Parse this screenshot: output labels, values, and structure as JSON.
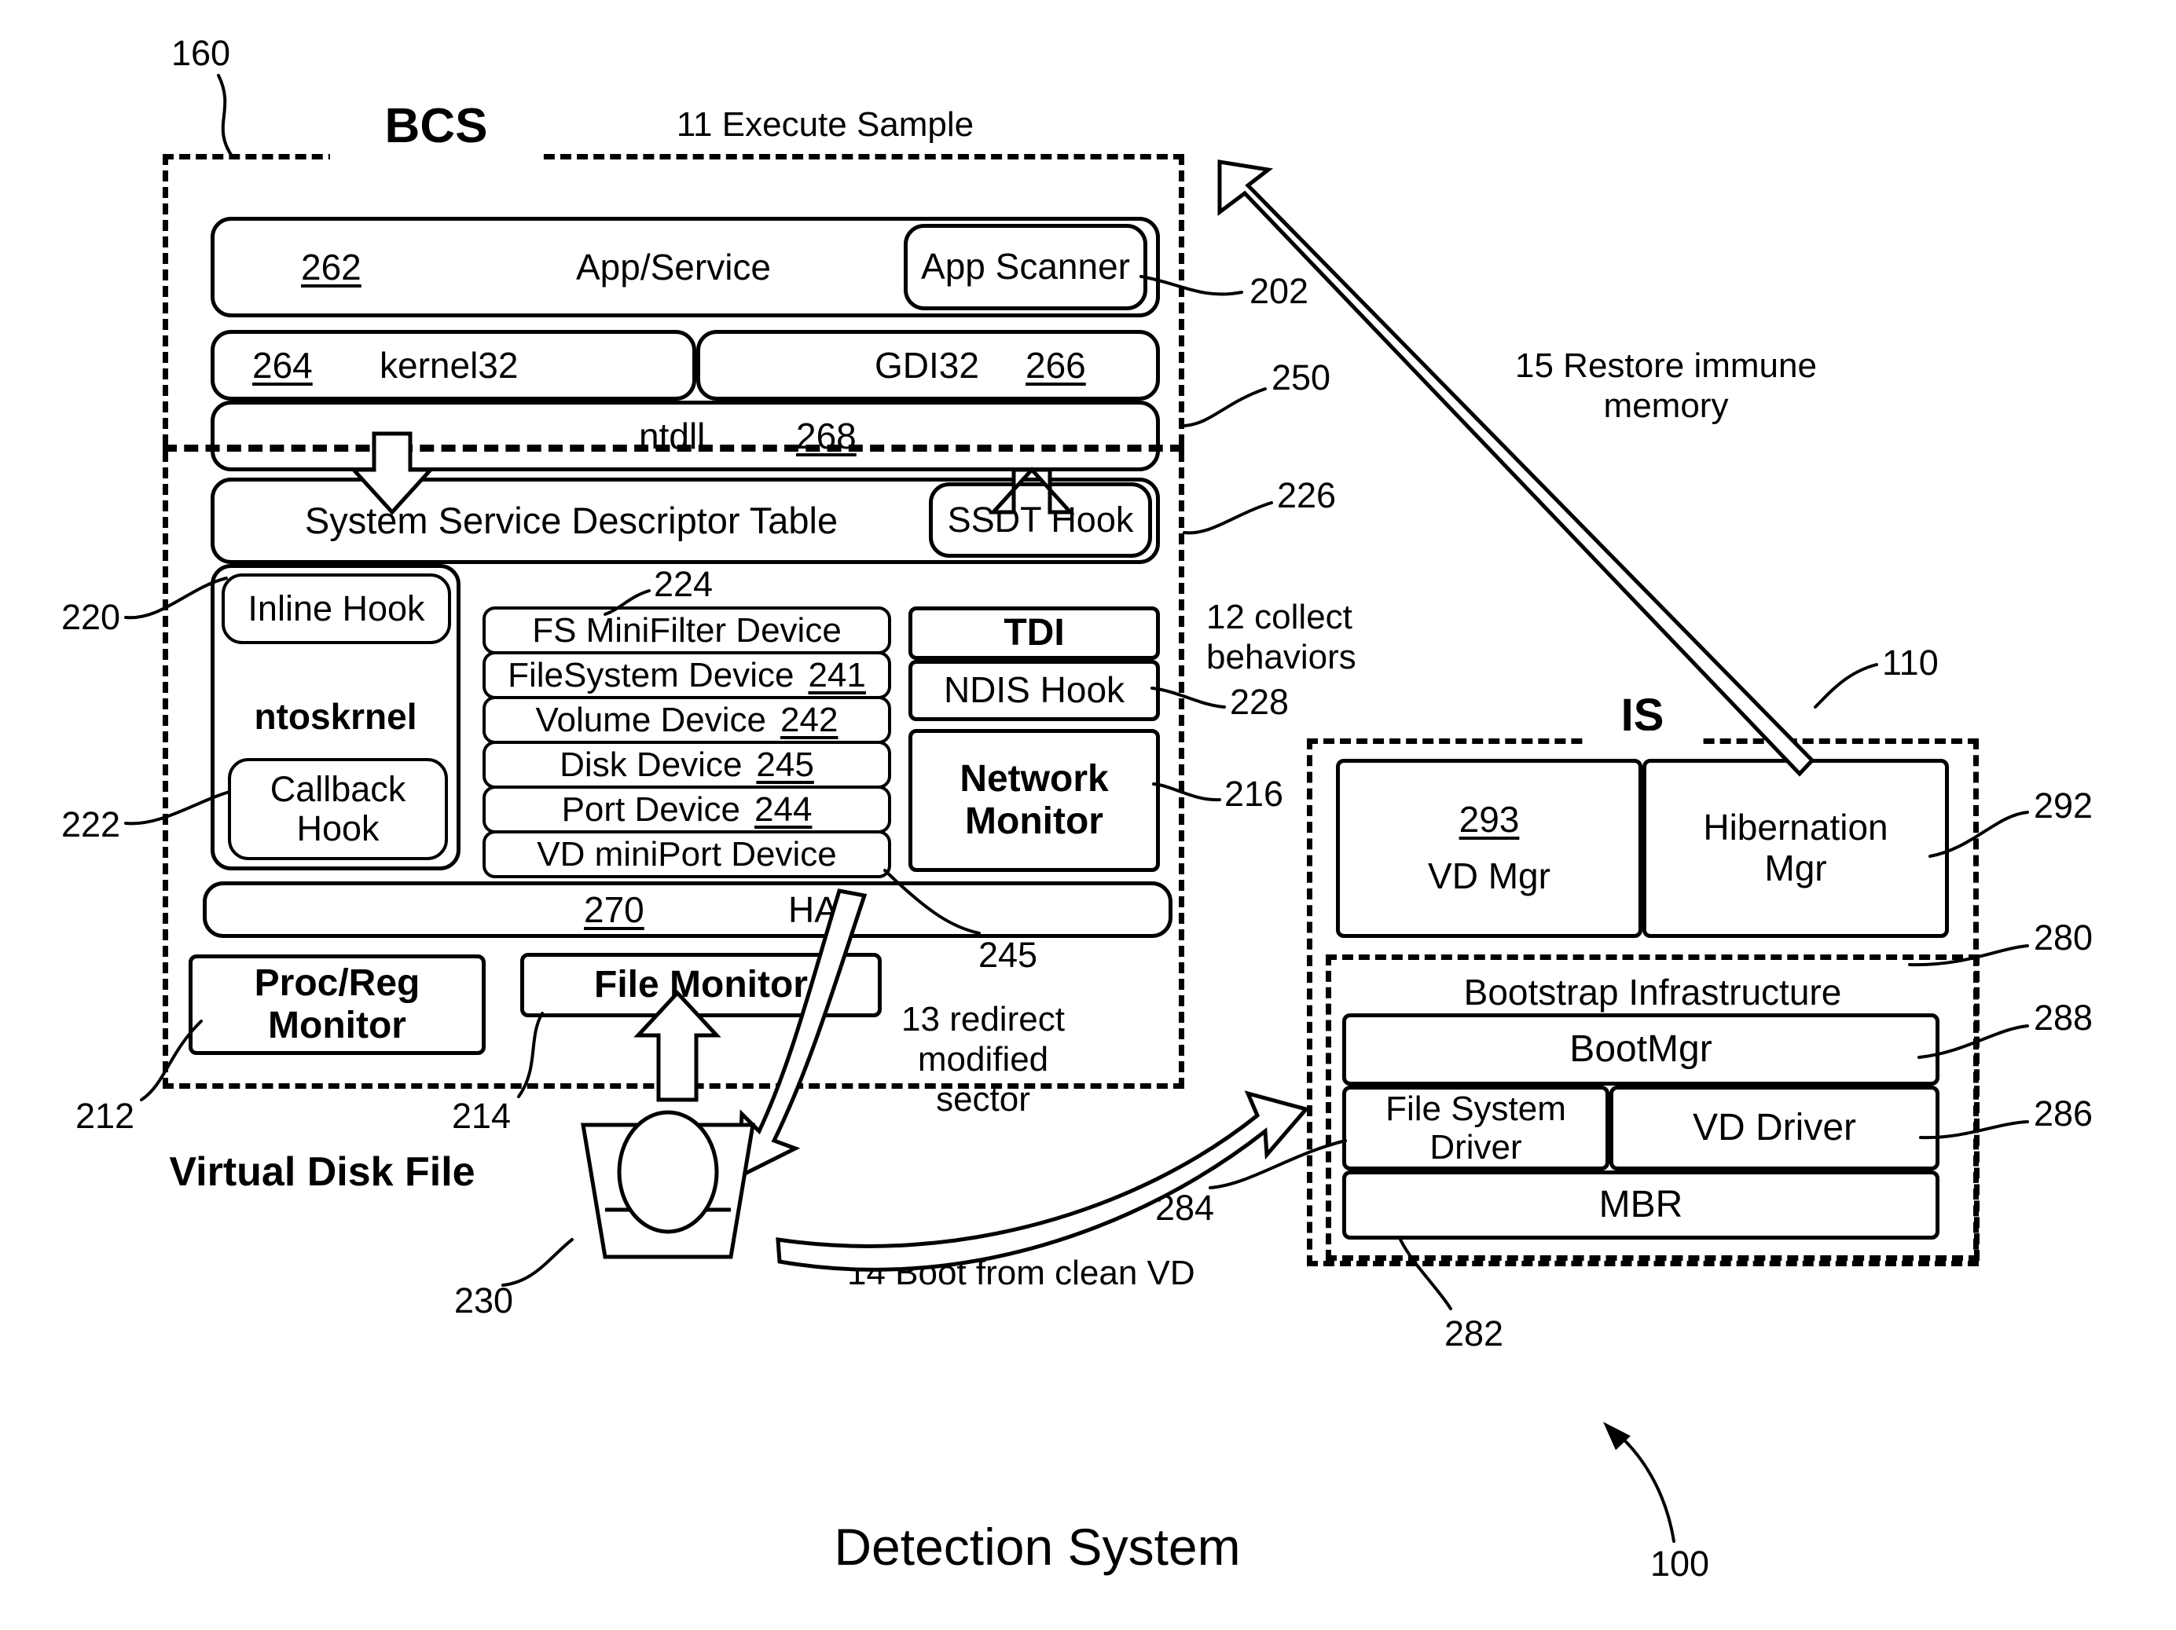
{
  "figure": {
    "caption": "Detection System",
    "caption_ref": "100",
    "bcs_title": "BCS",
    "bcs_ref": "160",
    "is_title": "IS",
    "is_ref": "110",
    "virtual_disk_file": "Virtual Disk File"
  },
  "steps": {
    "s11": "11 Execute Sample",
    "s12": "12 collect\nbehaviors",
    "s13": "13 redirect\nmodified\nsector",
    "s14": "14 Boot from clean VD",
    "s15": "15 Restore immune\nmemory"
  },
  "bcs": {
    "app_service": {
      "ref": "262",
      "label": "App/Service"
    },
    "app_scanner": {
      "label": "App Scanner",
      "ref": "202"
    },
    "kernel32": {
      "ref": "264",
      "label": "kernel32"
    },
    "gdi32": {
      "label": "GDI32",
      "ref": "266"
    },
    "ntdll": {
      "label": "ntdll",
      "ref": "268"
    },
    "user_kernel_boundary_ref": "250",
    "ssdt": {
      "label": "System Service Descriptor Table"
    },
    "ssdt_hook": {
      "label": "SSDT Hook",
      "ref": "226"
    },
    "ntoskrnel": {
      "label": "ntoskrnel"
    },
    "inline_hook": {
      "label": "Inline Hook",
      "ref": "220"
    },
    "callback_hook": {
      "label": "Callback\nHook",
      "ref": "222"
    },
    "device_stack_ref": "224",
    "devices": [
      {
        "label": "FS MiniFilter Device",
        "ref": ""
      },
      {
        "label": "FileSystem Device",
        "ref": "241"
      },
      {
        "label": "Volume Device",
        "ref": "242"
      },
      {
        "label": "Disk Device",
        "ref": "245"
      },
      {
        "label": "Port Device",
        "ref": "244"
      },
      {
        "label": "VD miniPort Device",
        "ref": ""
      }
    ],
    "disk_device_callout_ref": "245",
    "tdi": {
      "label": "TDI"
    },
    "ndis_hook": {
      "label": "NDIS Hook",
      "ref": "228"
    },
    "network_monitor": {
      "label": "Network\nMonitor",
      "ref": "216"
    },
    "hal": {
      "ref": "270",
      "label": "HAL"
    },
    "proc_reg_monitor": {
      "label": "Proc/Reg\nMonitor",
      "ref": "212"
    },
    "file_monitor": {
      "label": "File Monitor",
      "ref": "214"
    },
    "vd_icon_ref": "230"
  },
  "is": {
    "vd_mgr": {
      "ref": "293",
      "label": "VD Mgr"
    },
    "hibernation_mgr": {
      "label": "Hibernation\nMgr",
      "ref": "292"
    },
    "bootstrap": {
      "label": "Bootstrap Infrastructure",
      "ref": "280"
    },
    "bootmgr": {
      "label": "BootMgr",
      "ref": "288"
    },
    "file_system_driver": {
      "label": "File System\nDriver",
      "ref": "284"
    },
    "vd_driver": {
      "label": "VD Driver",
      "ref": "286"
    },
    "mbr": {
      "label": "MBR",
      "ref": "282"
    }
  }
}
